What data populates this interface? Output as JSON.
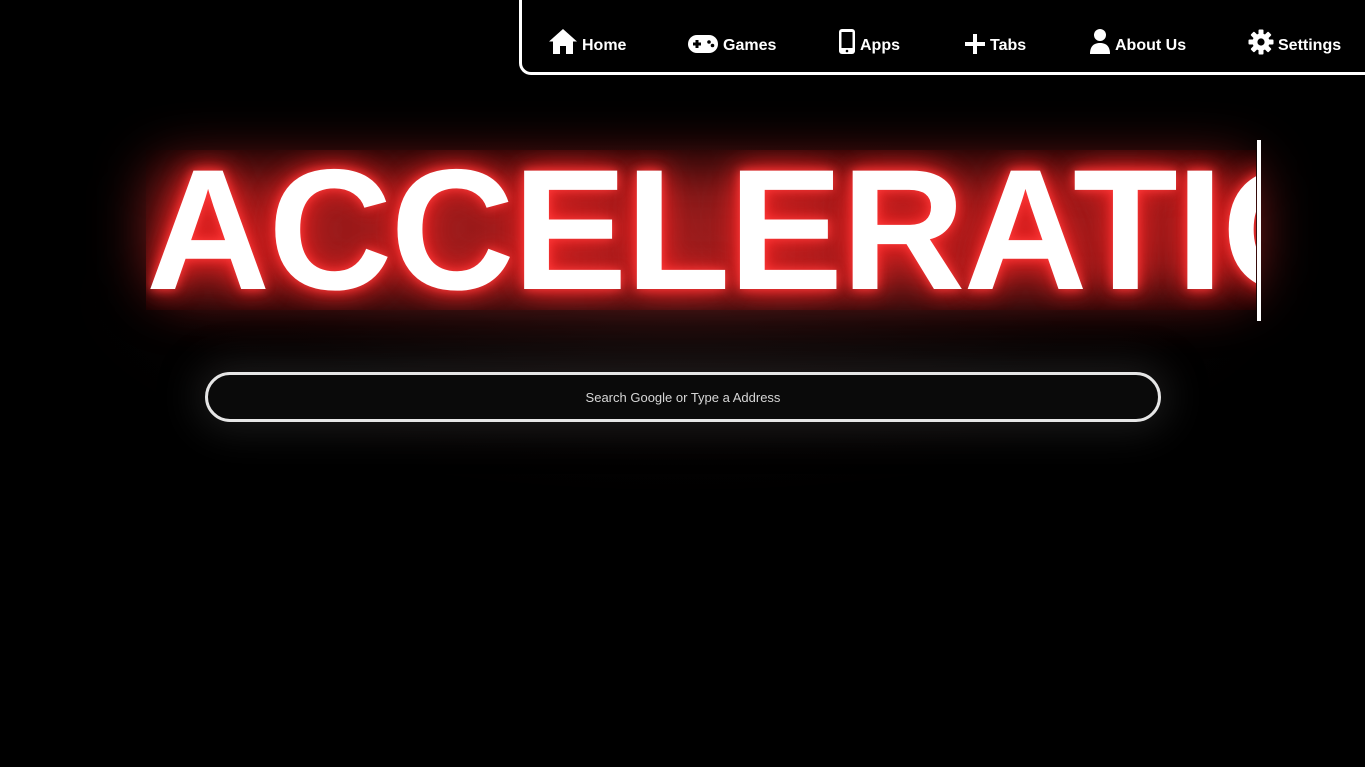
{
  "nav": {
    "items": [
      {
        "label": "Home",
        "icon": "home-icon"
      },
      {
        "label": "Games",
        "icon": "gamepad-icon"
      },
      {
        "label": "Apps",
        "icon": "mobile-icon"
      },
      {
        "label": "Tabs",
        "icon": "plus-icon"
      },
      {
        "label": "About Us",
        "icon": "user-icon"
      },
      {
        "label": "Settings",
        "icon": "gear-icon"
      }
    ]
  },
  "hero": {
    "title": "ACCELERATION",
    "glow_color": "#ff3030"
  },
  "search": {
    "placeholder": "Search Google or Type a Address",
    "value": ""
  },
  "colors": {
    "background": "#000000",
    "foreground": "#ffffff",
    "accent": "#ff3030"
  }
}
